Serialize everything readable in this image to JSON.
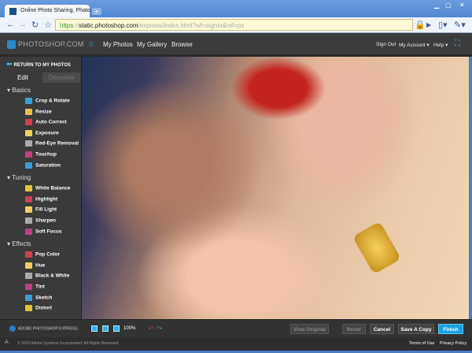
{
  "browser": {
    "tab_title": "Online Photo Sharing, Photo...",
    "url_scheme": "https",
    "url_host": "static.photoshop.com",
    "url_path": "/express/index.html?wf=signin&ref=ps"
  },
  "header": {
    "logo": "PHOTOSHOP.COM",
    "nav": [
      "My Photos",
      "My Gallery",
      "Browse"
    ],
    "sign_out": "Sign Out",
    "my_account": "My Account",
    "help": "Help"
  },
  "sidebar": {
    "return": "RETURN TO MY PHOTOS",
    "tabs": [
      "Edit",
      "Decorate"
    ],
    "sections": [
      {
        "title": "Basics",
        "items": [
          "Crop & Rotate",
          "Resize",
          "Auto Correct",
          "Exposure",
          "Red-Eye Removal",
          "Touchup",
          "Saturation"
        ]
      },
      {
        "title": "Tuning",
        "items": [
          "White Balance",
          "Highlight",
          "Fill Light",
          "Sharpen",
          "Soft Focus"
        ]
      },
      {
        "title": "Effects",
        "items": [
          "Pop Color",
          "Hue",
          "Black & White",
          "Tint",
          "Sketch",
          "Distort"
        ]
      }
    ]
  },
  "bottom": {
    "product": "ADOBE PHOTOSHOP EXPRESS",
    "zoom": "100%",
    "view_original": "View Original",
    "reset": "Reset",
    "cancel": "Cancel",
    "save_copy": "Save A Copy",
    "finish": "Finish"
  },
  "footer": {
    "copyright": "© 2010 Adobe Systems Incorporated. All Rights Reserved.",
    "terms": "Terms of Use",
    "privacy": "Privacy Policy"
  },
  "colors": {
    "accent": "#3aaeea",
    "finish": "#1aa0e0"
  }
}
